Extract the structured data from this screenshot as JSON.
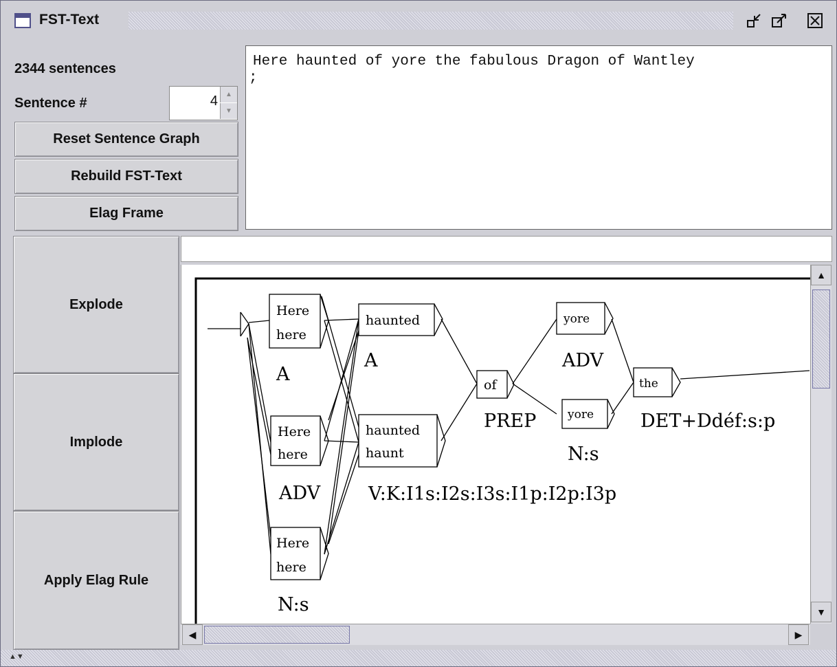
{
  "window": {
    "title": "FST-Text",
    "controls": [
      "minimize-icon",
      "maximize-icon",
      "close-icon"
    ]
  },
  "info": {
    "sentence_count": "2344 sentences",
    "sentence_label": "Sentence #",
    "sentence_value": "4"
  },
  "buttons": {
    "reset": "Reset Sentence Graph",
    "rebuild": "Rebuild FST-Text",
    "elag_frame": "Elag Frame",
    "explode": "Explode",
    "implode": "Implode",
    "apply_elag": "Apply Elag Rule"
  },
  "text_area": {
    "line1": "Here haunted of yore the fabulous Dragon of Wantley",
    "line2": ";"
  },
  "graph": {
    "boxes": {
      "here_a": [
        "Here",
        "here"
      ],
      "here_adv": [
        "Here",
        "here"
      ],
      "here_ns": [
        "Here",
        "here"
      ],
      "haunted_a": [
        "haunted"
      ],
      "haunted_v": [
        "haunted",
        "haunt"
      ],
      "of": [
        "of"
      ],
      "yore_adv": [
        "yore"
      ],
      "yore_ns": [
        "yore"
      ],
      "the": [
        "the"
      ]
    },
    "tags": {
      "here_a": "A",
      "here_adv": "ADV",
      "here_ns": "N:s",
      "haunted_a": "A",
      "haunted_v": "V:K:I1s:I2s:I3s:I1p:I2p:I3p",
      "of": "PREP",
      "yore_adv": "ADV",
      "yore_ns": "N:s",
      "the": "DET+Ddéf:s:p"
    }
  }
}
